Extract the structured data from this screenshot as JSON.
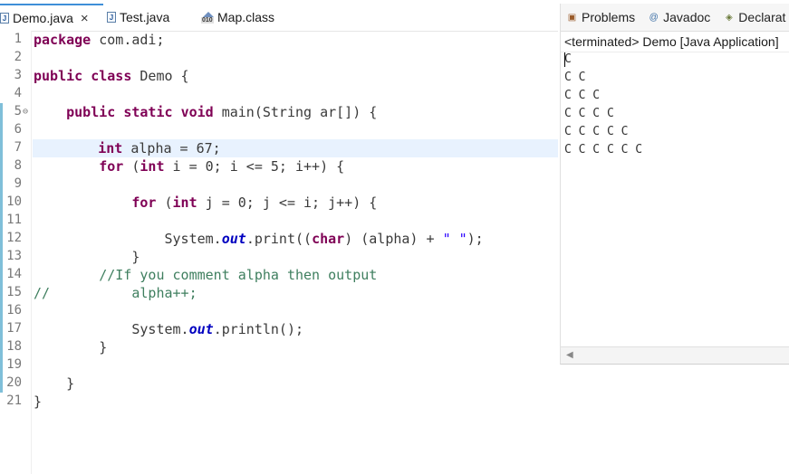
{
  "editor_tabs": [
    {
      "label": "Demo.java",
      "active": true,
      "icon": "java-file-icon"
    },
    {
      "label": "Test.java",
      "active": false,
      "icon": "java-file-icon"
    },
    {
      "label": "Map.class",
      "active": false,
      "icon": "class-file-icon"
    }
  ],
  "class_icon_text": "010",
  "java_icon_text": "J",
  "close_glyph": "×",
  "lines": [
    {
      "n": "1",
      "tokens": [
        {
          "t": "package",
          "c": "kw"
        },
        {
          "t": " com.adi;"
        }
      ]
    },
    {
      "n": "2",
      "tokens": []
    },
    {
      "n": "3",
      "tokens": [
        {
          "t": "public",
          "c": "kw"
        },
        {
          "t": " "
        },
        {
          "t": "class",
          "c": "kw"
        },
        {
          "t": " Demo {"
        }
      ]
    },
    {
      "n": "4",
      "tokens": []
    },
    {
      "n": "5",
      "fold": "⊖",
      "tokens": [
        {
          "t": "    "
        },
        {
          "t": "public",
          "c": "kw"
        },
        {
          "t": " "
        },
        {
          "t": "static",
          "c": "kw"
        },
        {
          "t": " "
        },
        {
          "t": "void",
          "c": "kw"
        },
        {
          "t": " main(String ar[]) {"
        }
      ]
    },
    {
      "n": "6",
      "tokens": []
    },
    {
      "n": "7",
      "highlight": true,
      "tokens": [
        {
          "t": "        "
        },
        {
          "t": "int",
          "c": "kw"
        },
        {
          "t": " alpha = 67;"
        }
      ]
    },
    {
      "n": "8",
      "tokens": [
        {
          "t": "        "
        },
        {
          "t": "for",
          "c": "kw"
        },
        {
          "t": " ("
        },
        {
          "t": "int",
          "c": "kw"
        },
        {
          "t": " i = 0; i <= 5; i++) {"
        }
      ]
    },
    {
      "n": "9",
      "tokens": []
    },
    {
      "n": "10",
      "tokens": [
        {
          "t": "            "
        },
        {
          "t": "for",
          "c": "kw"
        },
        {
          "t": " ("
        },
        {
          "t": "int",
          "c": "kw"
        },
        {
          "t": " j = 0; j <= i; j++) {"
        }
      ]
    },
    {
      "n": "11",
      "tokens": []
    },
    {
      "n": "12",
      "tokens": [
        {
          "t": "                System."
        },
        {
          "t": "out",
          "c": "fld"
        },
        {
          "t": ".print(("
        },
        {
          "t": "char",
          "c": "kw"
        },
        {
          "t": ") (alpha) + "
        },
        {
          "t": "\" \"",
          "c": "str"
        },
        {
          "t": ");"
        }
      ]
    },
    {
      "n": "13",
      "tokens": [
        {
          "t": "            }"
        }
      ]
    },
    {
      "n": "14",
      "tokens": [
        {
          "t": "        "
        },
        {
          "t": "//If you comment alpha then output",
          "c": "cmt"
        }
      ]
    },
    {
      "n": "15",
      "tokens": [
        {
          "t": "//",
          "c": "cmt"
        },
        {
          "t": "          alpha++;",
          "c": "cmt"
        }
      ]
    },
    {
      "n": "16",
      "tokens": []
    },
    {
      "n": "17",
      "tokens": [
        {
          "t": "            System."
        },
        {
          "t": "out",
          "c": "fld"
        },
        {
          "t": ".println();"
        }
      ]
    },
    {
      "n": "18",
      "tokens": [
        {
          "t": "        }"
        }
      ]
    },
    {
      "n": "19",
      "tokens": []
    },
    {
      "n": "20",
      "tokens": [
        {
          "t": "    }"
        }
      ]
    },
    {
      "n": "21",
      "tokens": [
        {
          "t": "}"
        }
      ]
    }
  ],
  "console": {
    "tabs": [
      {
        "label": "Problems",
        "icon": "problems-icon",
        "glyph": "▣"
      },
      {
        "label": "Javadoc",
        "icon": "javadoc-icon",
        "glyph": "@"
      },
      {
        "label": "Declarat",
        "icon": "declaration-icon",
        "glyph": "◈"
      }
    ],
    "title": "<terminated> Demo [Java Application]",
    "output": [
      "C",
      "C C",
      "C C C",
      "C C C C",
      "C C C C C",
      "C C C C C C"
    ],
    "scroll_left": "◀"
  }
}
